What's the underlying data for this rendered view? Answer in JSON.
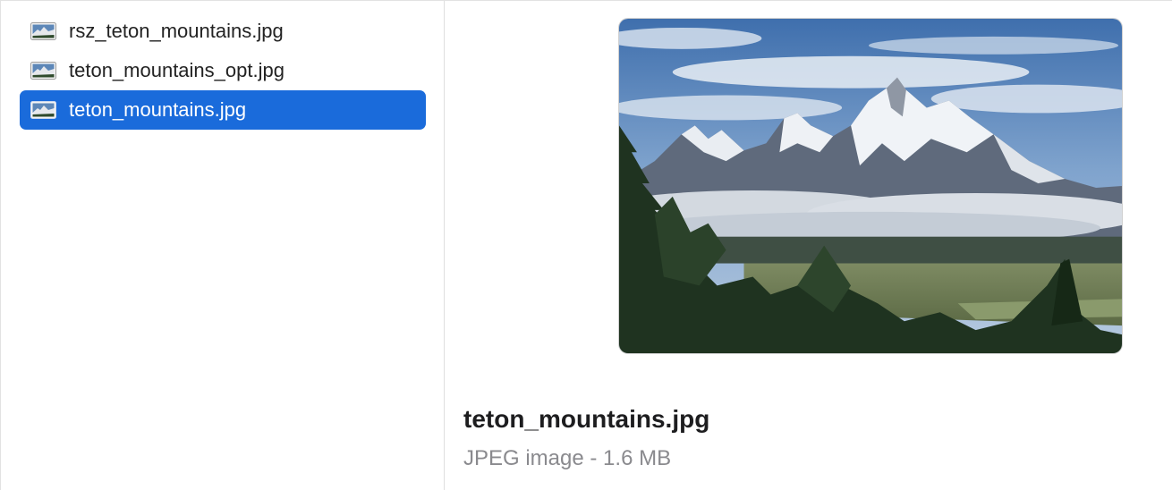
{
  "files": [
    {
      "name": "rsz_teton_mountains.jpg",
      "icon": "jpeg-thumbnail-icon",
      "selected": false
    },
    {
      "name": "teton_mountains_opt.jpg",
      "icon": "jpeg-thumbnail-icon",
      "selected": false
    },
    {
      "name": "teton_mountains.jpg",
      "icon": "jpeg-thumbnail-icon",
      "selected": true
    }
  ],
  "preview": {
    "filename": "teton_mountains.jpg",
    "kind_size": "JPEG image - 1.6 MB",
    "image_subject": "mountain-landscape-preview"
  },
  "colors": {
    "selection": "#1a6bdb",
    "secondary_text": "#8a8a8e"
  }
}
